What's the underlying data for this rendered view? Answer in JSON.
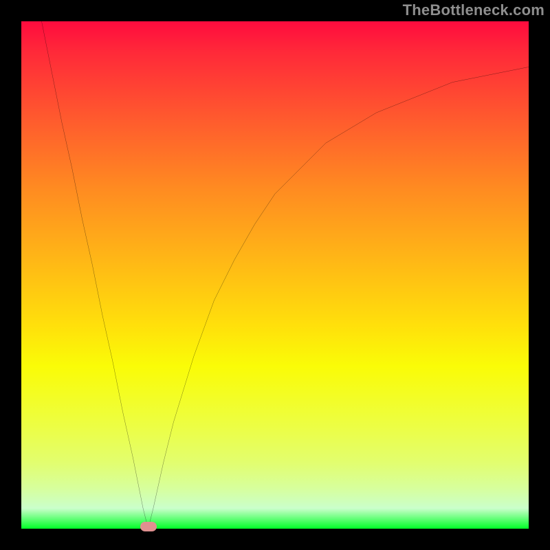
{
  "watermark": "TheBottleneck.com",
  "chart_data": {
    "type": "line",
    "title": "",
    "xlabel": "",
    "ylabel": "",
    "xlim": [
      0,
      100
    ],
    "ylim": [
      0,
      100
    ],
    "grid": false,
    "legend": false,
    "background_gradient": [
      "#ff0b3e",
      "#ffb716",
      "#fafc07",
      "#00ff27"
    ],
    "series": [
      {
        "name": "bottleneck-curve",
        "x": [
          4,
          6,
          8,
          10,
          12,
          14,
          16,
          18,
          20,
          22,
          24,
          25,
          26,
          28,
          30,
          34,
          38,
          42,
          46,
          50,
          55,
          60,
          65,
          70,
          75,
          80,
          85,
          90,
          95,
          100
        ],
        "values": [
          100,
          90,
          80,
          71,
          61,
          52,
          42,
          33,
          23,
          14,
          4,
          0,
          4,
          13,
          21,
          34,
          45,
          53,
          60,
          66,
          71,
          76,
          79,
          82,
          84,
          86,
          88,
          89,
          90,
          91
        ]
      }
    ],
    "marker": {
      "x": 25,
      "y": 0,
      "color": "#e09090"
    }
  }
}
